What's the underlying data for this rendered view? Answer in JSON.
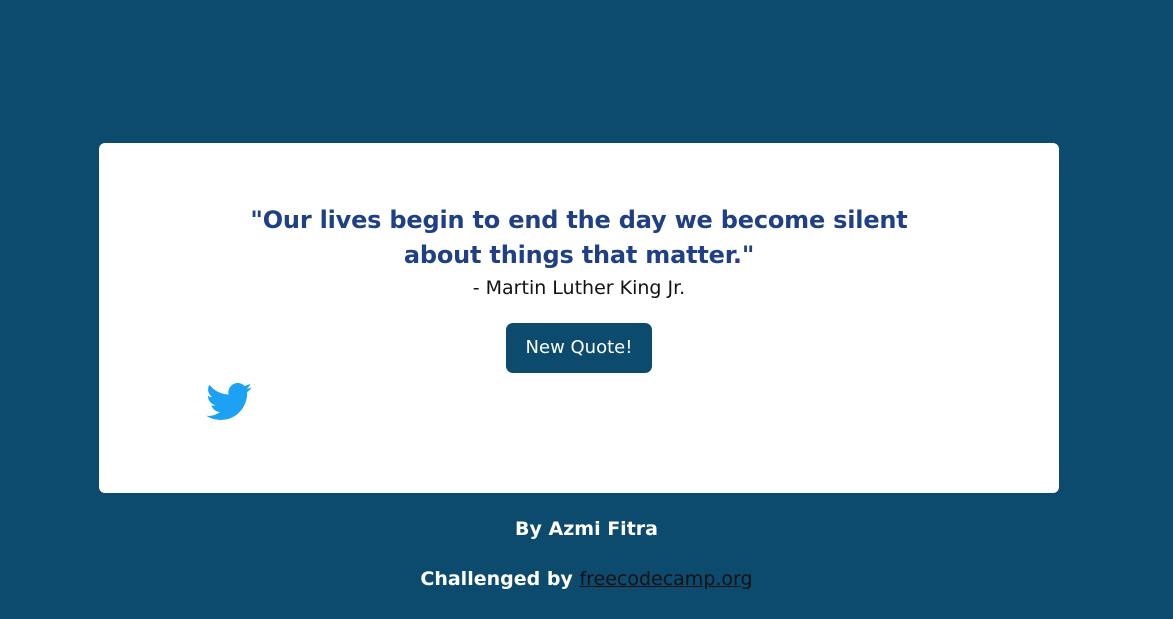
{
  "quote": {
    "text": "\"Our lives begin to end the day we become silent about things that matter.\"",
    "author": "- Martin Luther King Jr."
  },
  "actions": {
    "new_quote_label": "New Quote!",
    "tweet_icon": "twitter-bird-icon"
  },
  "footer": {
    "by_text": "By Azmi Fitra",
    "challenged_prefix": "Challenged by",
    "link_text": "freecodecamp.org"
  },
  "colors": {
    "background": "#0d4b6e",
    "card": "#ffffff",
    "quote_text": "#1f3f86",
    "button": "#0d4b6e",
    "twitter": "#1da1f2"
  }
}
